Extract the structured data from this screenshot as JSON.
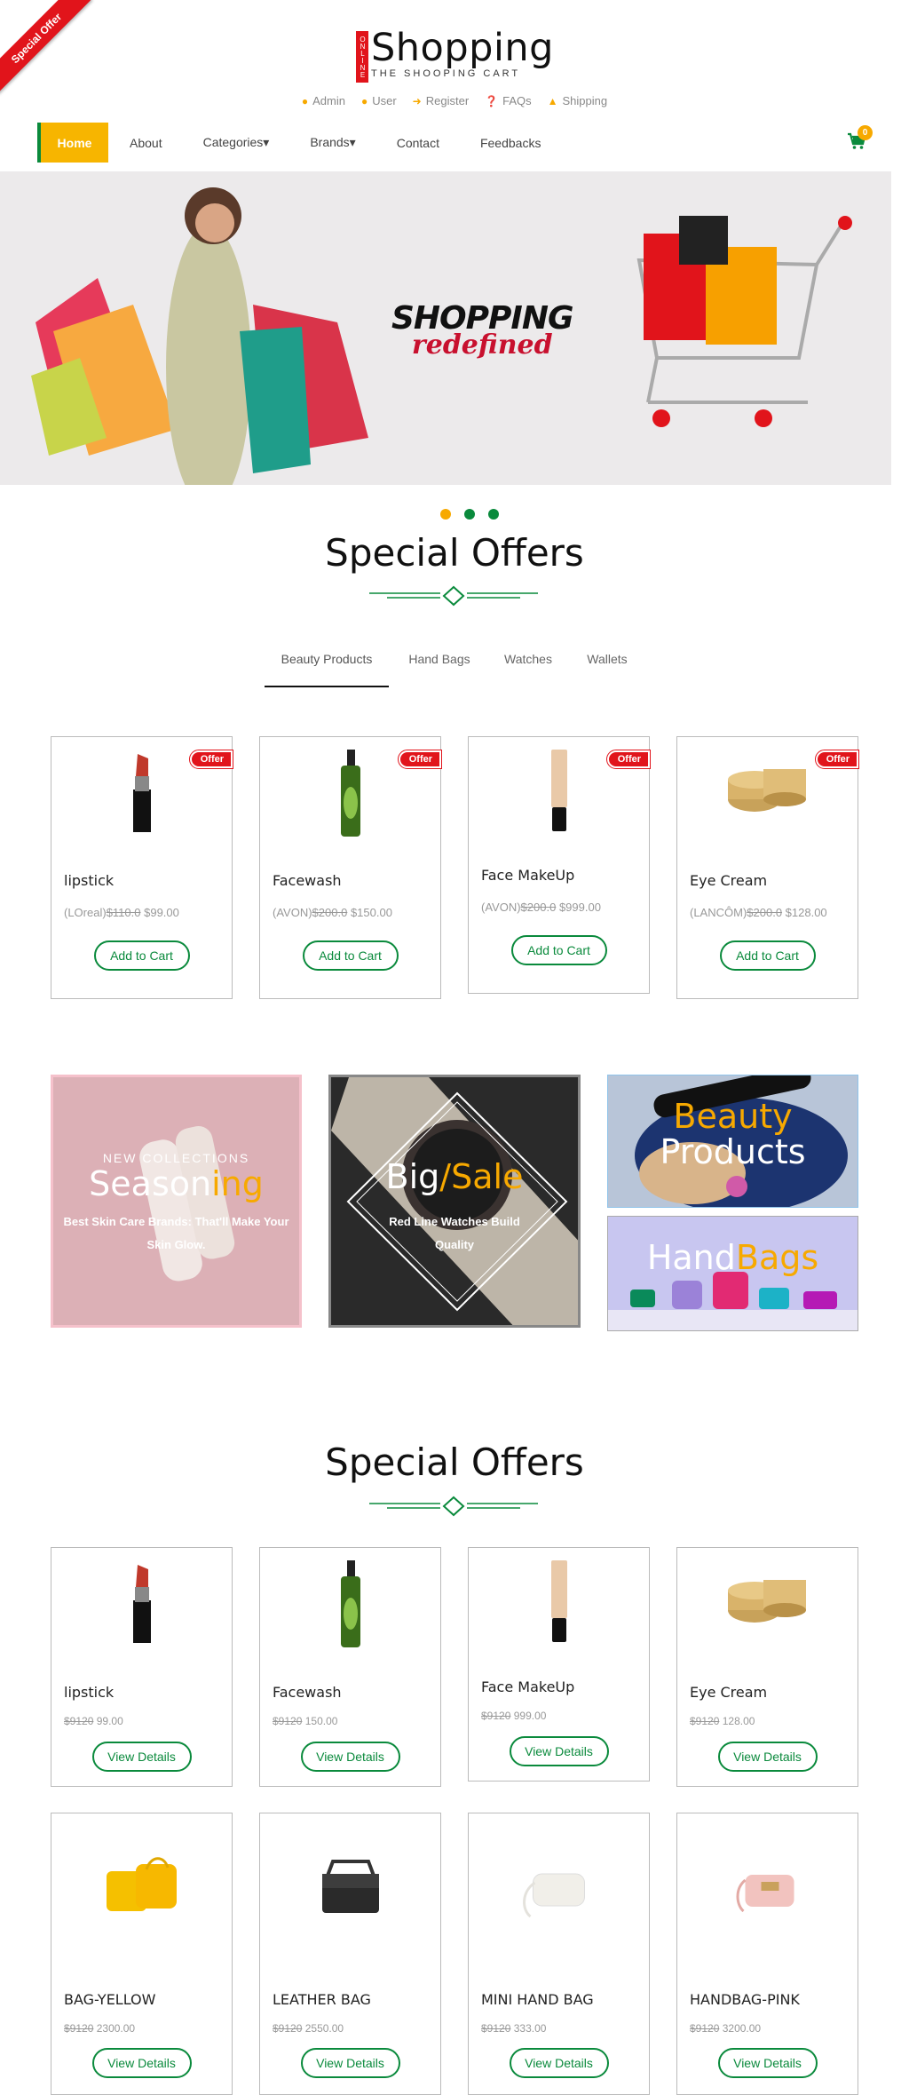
{
  "ribbon": "Special Offer",
  "logo": {
    "vertical": "ONLINE",
    "title": "Shopping",
    "subtitle": "THE SHOOPING CART"
  },
  "toplinks": [
    "Admin",
    "User",
    "Register",
    "FAQs",
    "Shipping"
  ],
  "nav": {
    "items": [
      "Home",
      "About",
      "Categories▾",
      "Brands▾",
      "Contact",
      "Feedbacks"
    ],
    "cart_count": "0"
  },
  "hero": {
    "title": "SHOPPING",
    "subtitle": "redefined"
  },
  "section1": {
    "title": "Special Offers",
    "tabs": [
      "Beauty Products",
      "Hand Bags",
      "Watches",
      "Wallets"
    ],
    "products": [
      {
        "badge": "Offer",
        "name": "lipstick",
        "brand": "(LOreal)",
        "old": "$110.0",
        "price": "$99.00",
        "button": "Add to Cart"
      },
      {
        "badge": "Offer",
        "name": "Facewash",
        "brand": "(AVON)",
        "old": "$200.0",
        "price": "$150.00",
        "button": "Add to Cart"
      },
      {
        "badge": "Offer",
        "name": "Face MakeUp",
        "brand": "(AVON)",
        "old": "$200.0",
        "price": "$999.00",
        "button": "Add to Cart"
      },
      {
        "badge": "Offer",
        "name": "Eye Cream",
        "brand": "(LANCÔM)",
        "old": "$200.0",
        "price": "$128.00",
        "button": "Add to Cart"
      }
    ]
  },
  "promos": {
    "seasoning": {
      "kicker": "NEW COLLECTIONS",
      "big1": "Season",
      "big2": "ing",
      "small": "Best Skin Care Brands: That'll Make Your Skin Glow."
    },
    "bigsale": {
      "big1": "Big",
      "slash": "/",
      "big2": "Sale",
      "small": "Red Line Watches Build Quality"
    },
    "beauty": {
      "line1": "Beauty",
      "line2": "Products"
    },
    "handbags": {
      "part1": "Hand",
      "part2": "Bags"
    }
  },
  "section2": {
    "title": "Special Offers",
    "products": [
      {
        "name": "lipstick",
        "old": "$9120",
        "price": "99.00",
        "button": "View Details"
      },
      {
        "name": "Facewash",
        "old": "$9120",
        "price": "150.00",
        "button": "View Details"
      },
      {
        "name": "Face MakeUp",
        "old": "$9120",
        "price": "999.00",
        "button": "View Details"
      },
      {
        "name": "Eye Cream",
        "old": "$9120",
        "price": "128.00",
        "button": "View Details"
      },
      {
        "name": "BAG-YELLOW",
        "old": "$9120",
        "price": "2300.00",
        "button": "View Details"
      },
      {
        "name": "LEATHER BAG",
        "old": "$9120",
        "price": "2550.00",
        "button": "View Details"
      },
      {
        "name": "MINI HAND BAG",
        "old": "$9120",
        "price": "333.00",
        "button": "View Details"
      },
      {
        "name": "HANDBAG-PINK",
        "old": "$9120",
        "price": "3200.00",
        "button": "View Details"
      }
    ]
  },
  "colors": {
    "accent": "#f7b500",
    "green": "#0a8a3c",
    "red": "#e1141b"
  }
}
